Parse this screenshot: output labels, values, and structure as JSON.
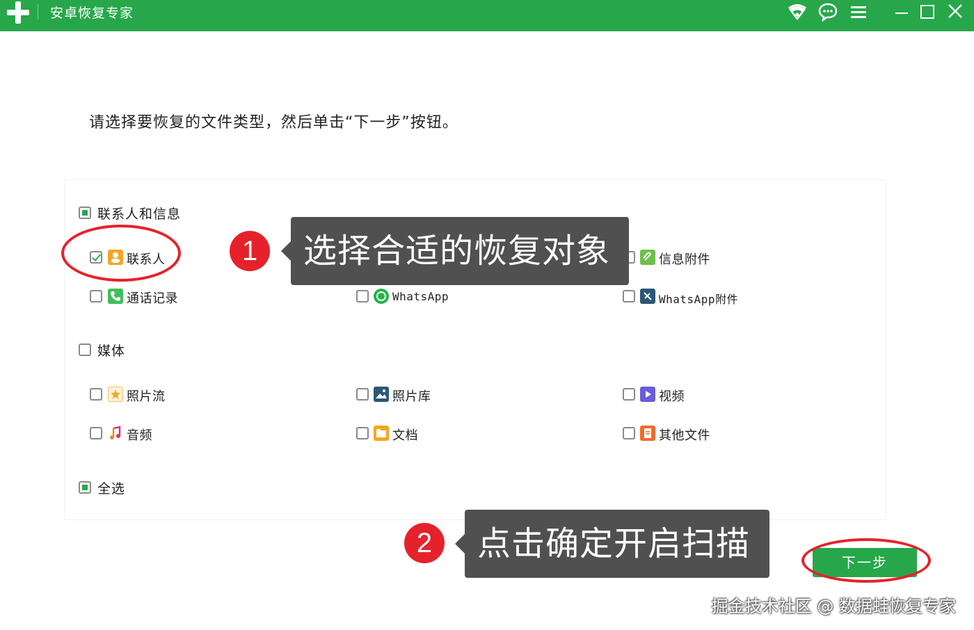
{
  "titlebar": {
    "app_title": "安卓恢复专家",
    "icons": [
      "plus-logo-icon",
      "wifi-icon",
      "chat-icon",
      "menu-icon",
      "minimize-icon",
      "maximize-icon",
      "close-icon"
    ],
    "color": "#27a74a"
  },
  "instruction": "请选择要恢复的文件类型，然后单击“下一步”按钮。",
  "groups": {
    "contacts_messages": {
      "label": "联系人和信息",
      "state": "partial",
      "items": [
        {
          "label": "联系人",
          "checked": true,
          "icon": "contacts-icon"
        },
        {
          "label": "信息附件",
          "checked": false,
          "icon": "message-attachment-icon"
        },
        {
          "label": "通话记录",
          "checked": false,
          "icon": "call-log-icon"
        },
        {
          "label": "WhatsApp",
          "checked": false,
          "icon": "whatsapp-icon"
        },
        {
          "label": "WhatsApp附件",
          "checked": false,
          "icon": "whatsapp-attachment-icon"
        }
      ]
    },
    "media": {
      "label": "媒体",
      "state": "unchecked",
      "items": [
        {
          "label": "照片流",
          "checked": false,
          "icon": "photo-stream-icon"
        },
        {
          "label": "照片库",
          "checked": false,
          "icon": "photo-library-icon"
        },
        {
          "label": "视频",
          "checked": false,
          "icon": "video-icon"
        },
        {
          "label": "音频",
          "checked": false,
          "icon": "audio-icon"
        },
        {
          "label": "文档",
          "checked": false,
          "icon": "document-icon"
        },
        {
          "label": "其他文件",
          "checked": false,
          "icon": "other-files-icon"
        }
      ]
    },
    "select_all": {
      "label": "全选",
      "state": "partial"
    }
  },
  "annotations": {
    "step1_number": "1",
    "step1_text": "选择合适的恢复对象",
    "step2_number": "2",
    "step2_text": "点击确定开启扫描",
    "ring_color": "#e5222b"
  },
  "next_button": "下一步",
  "watermark": "掘金技术社区 @ 数据蛙恢复专家"
}
